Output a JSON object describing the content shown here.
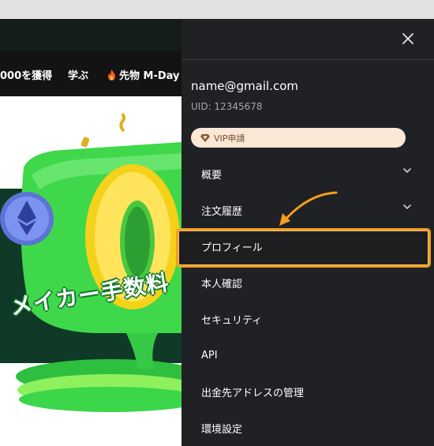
{
  "background_page": {
    "nav": {
      "earn": "000を獲得",
      "learn": "学ぶ",
      "futures": "先物 M-Day"
    },
    "banner": {
      "headline": "メイカー手数料"
    }
  },
  "drawer": {
    "close_icon": "close-icon",
    "email": "name@gmail.com",
    "uid": "UID: 12345678",
    "vip_label": "VIP申請",
    "menu": {
      "overview": "概要",
      "orders": "注文履歴",
      "profile": "プロフィール",
      "kyc": "本人確認",
      "security": "セキュリティ",
      "api": "API",
      "withdraw_address": "出金先アドレスの管理",
      "settings": "環境設定"
    }
  },
  "colors": {
    "drawer_bg": "#202124",
    "highlight": "#f29f1f",
    "vip_bg": "#fbe7d6",
    "banner_green": "#0f3a27"
  }
}
